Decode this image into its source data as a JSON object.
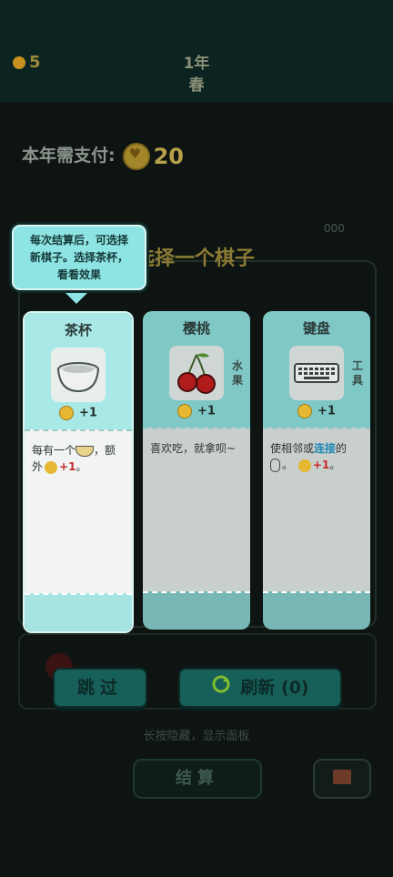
{
  "topbar": {
    "coins": "5",
    "year_label": "1年",
    "season": "春"
  },
  "payment": {
    "label": "本年需支付:",
    "amount": "20"
  },
  "panel": {
    "title": "选择一个棋子",
    "count_hint": "000"
  },
  "tooltip": {
    "line1": "每次结算后，可选择",
    "line2": "新棋子。选择茶杯，",
    "line3": "看看效果"
  },
  "cards": [
    {
      "name": "茶杯",
      "icon": "bowl-icon",
      "bonus": "+1",
      "desc_pre": "每有一个",
      "desc_mid": "，额外",
      "desc_bonus": "+1",
      "desc_end": "。",
      "tag": ""
    },
    {
      "name": "樱桃",
      "icon": "cherry-icon",
      "bonus": "+1",
      "desc": "喜欢吃，就拿呗~",
      "tag": "水果"
    },
    {
      "name": "键盘",
      "icon": "keyboard-icon",
      "bonus": "+1",
      "desc_pre": "使相邻或",
      "desc_link": "连接",
      "desc_mid": "的",
      "desc_end": "。",
      "desc_bonus": "+1",
      "tag": "工具"
    }
  ],
  "buttons": {
    "skip": "跳过",
    "refresh": "刷新 (0)"
  },
  "hint": "长按隐藏，显示面板",
  "settle": "结算",
  "colors": {
    "teal": "#a8e9e8",
    "bonus_red": "#c52b2b",
    "link_blue": "#1e88b4",
    "coin": "#e6b832"
  }
}
